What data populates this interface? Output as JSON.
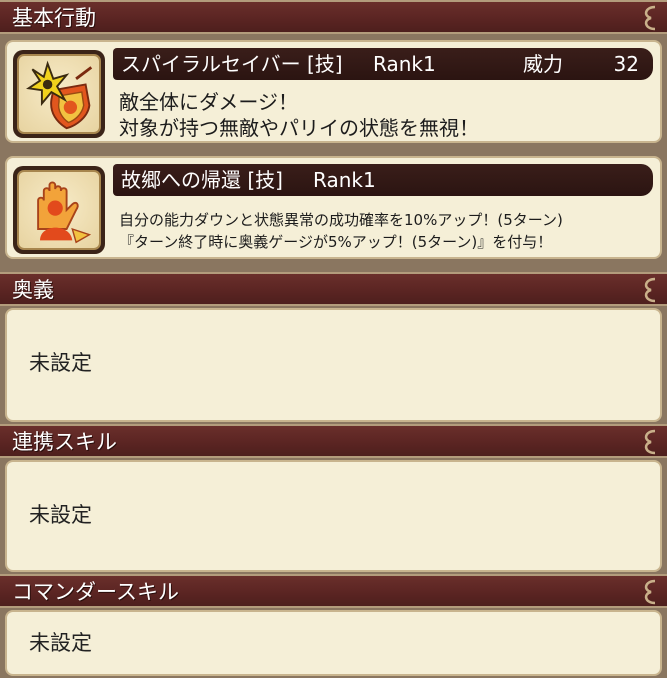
{
  "sections": {
    "basic_actions": {
      "title": "基本行動"
    },
    "ougi": {
      "title": "奥義",
      "value": "未設定"
    },
    "link_skill": {
      "title": "連携スキル",
      "value": "未設定"
    },
    "commander_skill": {
      "title": "コマンダースキル",
      "value": "未設定"
    }
  },
  "skills": [
    {
      "name": "スパイラルセイバー [技]",
      "rank": "Rank1",
      "power_label": "威力",
      "power_value": "32",
      "description": [
        "敵全体にダメージ！",
        "対象が持つ無敵やパリイの状態を無視！"
      ],
      "icon": "shuriken-shield-icon"
    },
    {
      "name": "故郷への帰還 [技]",
      "rank": "Rank1",
      "description": [
        "自分の能力ダウンと状態異常の成功確率を10%アップ！(5ターン)",
        "『ターン終了時に奥義ゲージが5%アップ！(5ターン)』を付与！"
      ],
      "icon": "hand-aura-icon"
    }
  ],
  "colors": {
    "header_bg": "#5a2422",
    "panel_bg": "#f5efd7",
    "title_bar_bg": "#2b1411",
    "page_bg": "#8a7660"
  }
}
